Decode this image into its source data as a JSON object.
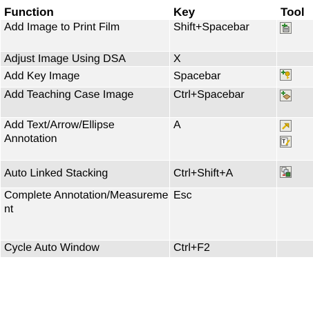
{
  "table": {
    "headers": {
      "function": "Function",
      "key": "Key",
      "tool": "Tool"
    },
    "rows": [
      {
        "function": "Add Image to Print Film",
        "key": "Shift+Spacebar",
        "tools": [
          "print-film-icon"
        ]
      },
      {
        "function": "Adjust Image Using DSA",
        "key": "X",
        "tools": []
      },
      {
        "function": "Add Key Image",
        "key": "Spacebar",
        "tools": [
          "key-image-icon"
        ]
      },
      {
        "function": "Add Teaching Case Image",
        "key": "Ctrl+Spacebar",
        "tools": [
          "teaching-case-icon"
        ]
      },
      {
        "function": "Add Text/Arrow/Ellipse Annotation",
        "key": "A",
        "tools": [
          "arrow-annotation-icon",
          "text-annotation-icon"
        ]
      },
      {
        "function": "Auto Linked Stacking",
        "key": "Ctrl+Shift+A",
        "tools": [
          "linked-stacking-icon"
        ]
      },
      {
        "function": "Complete Annotation/Measurement",
        "key": "Esc",
        "tools": []
      },
      {
        "function": "Cycle Auto Window",
        "key": "Ctrl+F2",
        "tools": []
      }
    ]
  },
  "colors": {
    "row_light": "#f2f2f2",
    "row_dark": "#e6e6e6",
    "icon_green": "#2e8b2e",
    "icon_yellow": "#e0b300"
  }
}
